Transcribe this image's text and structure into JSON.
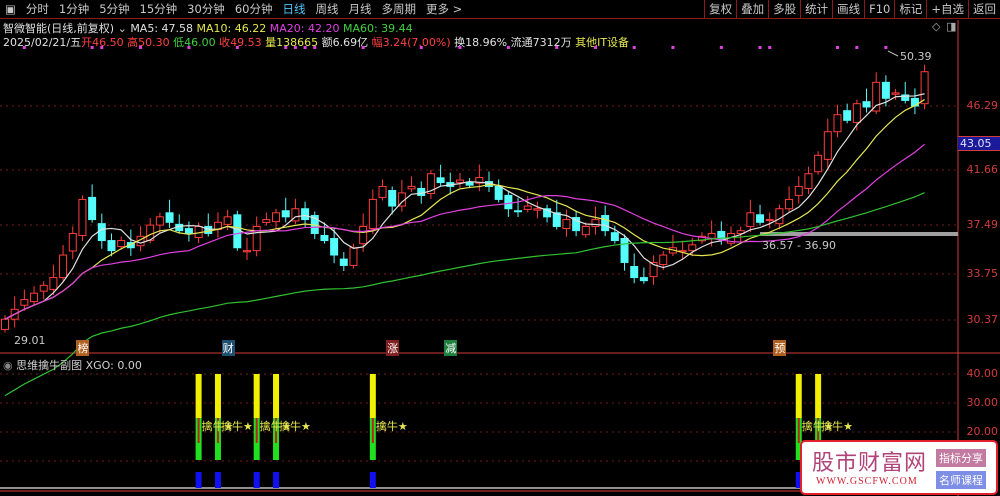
{
  "toolbar": {
    "tabs": [
      "分时",
      "1分钟",
      "5分钟",
      "15分钟",
      "30分钟",
      "60分钟",
      "日线",
      "周线",
      "月线",
      "多周期",
      "更多 >"
    ],
    "active_tab": "日线",
    "right_buttons": [
      "复权",
      "叠加",
      "多股",
      "统计",
      "画线",
      "F10",
      "标记",
      "+自选",
      "返回"
    ]
  },
  "info": {
    "title": "智微智能(日线,前复权)",
    "ma5": "MA5: 47.58",
    "ma10": "MA10: 46.22",
    "ma20": "MA20: 42.20",
    "ma60": "MA60: 39.44",
    "date": "2025/02/21/五",
    "open": "开46.50",
    "high": "高50.30",
    "low": "低46.00",
    "close": "收49.53",
    "volume": "量138665",
    "amount": "额6.69亿",
    "change": "幅3.24(7.00%)",
    "turnover": "换18.96%",
    "float": "流通7312万",
    "sector": "其他IT设备"
  },
  "price_axis": [
    "46.29",
    "41.66",
    "37.49",
    "33.75",
    "30.37"
  ],
  "current_price": "43.05",
  "annotations": {
    "high": "50.39",
    "low": "29.01",
    "range": "36.57 - 36.90"
  },
  "event_tags": [
    {
      "text": "榜",
      "color": "#b06020",
      "index": 8
    },
    {
      "text": "财",
      "color": "#205070",
      "index": 23
    },
    {
      "text": "涨",
      "color": "#802020",
      "index": 40
    },
    {
      "text": "减",
      "color": "#208040",
      "index": 46
    },
    {
      "text": "预",
      "color": "#b06020",
      "index": 80
    }
  ],
  "colors": {
    "up": "#ff3c3c",
    "down": "#54fcfc",
    "ma5": "#e0e0e0",
    "ma10": "#e6e650",
    "ma20": "#e040e0",
    "ma60": "#30c030",
    "axis": "#d23c3c"
  },
  "chart_data": {
    "type": "candlestick",
    "closes": [
      30.4,
      31.0,
      31.6,
      32.0,
      32.5,
      33.0,
      34.5,
      36.0,
      38.5,
      37.0,
      35.5,
      34.8,
      35.5,
      35.0,
      35.8,
      36.6,
      37.2,
      36.8,
      36.2,
      36.0,
      36.5,
      36.0,
      36.8,
      37.2,
      35.0,
      34.8,
      36.5,
      37.0,
      37.5,
      37.2,
      37.8,
      37.0,
      36.0,
      35.5,
      34.5,
      33.8,
      35.0,
      36.5,
      38.5,
      39.5,
      38.0,
      39.0,
      39.5,
      38.8,
      40.5,
      39.8,
      39.5,
      40.0,
      39.6,
      40.2,
      39.5,
      38.5,
      37.8,
      37.6,
      38.0,
      37.8,
      37.2,
      36.5,
      37.0,
      36.2,
      36.5,
      37.0,
      36.2,
      35.5,
      34.0,
      33.0,
      32.8,
      34.0,
      34.5,
      35.0,
      34.8,
      35.2,
      35.8,
      36.0,
      35.6,
      36.0,
      36.2,
      37.5,
      36.8,
      37.0,
      37.8,
      38.5,
      39.5,
      40.5,
      42.0,
      44.0,
      45.5,
      45.0,
      46.5,
      46.2,
      48.5,
      47.0,
      47.5,
      46.8,
      46.29,
      49.53
    ],
    "marker_dot_indices": [
      2,
      9,
      10,
      14,
      19,
      24,
      29,
      30,
      31,
      32,
      37,
      43,
      47,
      52,
      57,
      61,
      65,
      69,
      74,
      78,
      79,
      86,
      88,
      91
    ],
    "ylim": [
      29.0,
      51.0
    ]
  },
  "sub_panel": {
    "title": "思维擒牛副图",
    "value": "XGO: 0.00",
    "axis": [
      "40.00",
      "30.00",
      "20.00"
    ],
    "signal_label": "擒牛★",
    "signal_indices": [
      20,
      22,
      26,
      28,
      38,
      82,
      84
    ]
  },
  "watermark": {
    "name": "股市财富网",
    "url": "WWW.GSCFW.COM",
    "btn1": "指标分享",
    "btn2": "名师课程"
  }
}
